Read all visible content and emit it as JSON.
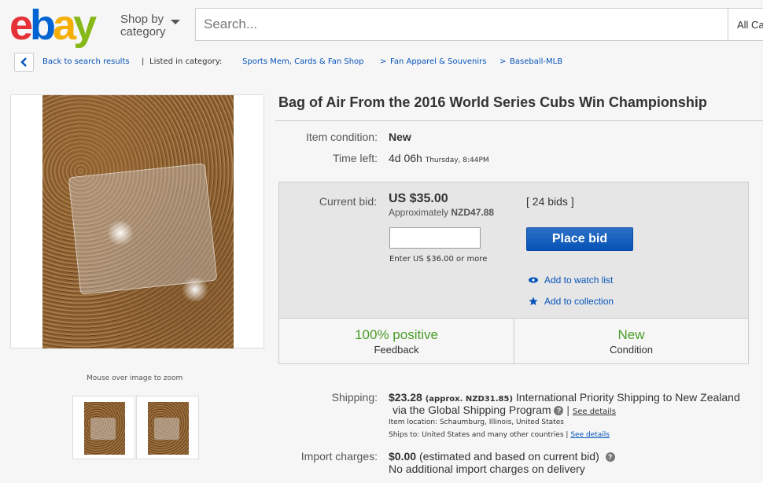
{
  "header": {
    "logo": {
      "e": "e",
      "b": "b",
      "a": "a",
      "y": "y"
    },
    "shop_by_line1": "Shop by",
    "shop_by_line2": "category",
    "search_placeholder": "Search...",
    "category_select": "All Ca"
  },
  "breadcrumb": {
    "back": "Back to search results",
    "separator": "|",
    "listed_in": "Listed in category:",
    "items": [
      "Sports Mem, Cards & Fan Shop",
      "Fan Apparel & Souvenirs",
      "Baseball-MLB"
    ],
    "arrow": ">"
  },
  "gallery": {
    "zoom_hint": "Mouse over image to zoom"
  },
  "item": {
    "title": "Bag of Air From the 2016 World Series Cubs Win Championship",
    "condition_label": "Item condition:",
    "condition_value": "New",
    "time_left_label": "Time left:",
    "time_left_value": "4d 06h",
    "time_left_end": "Thursday, 8:44PM"
  },
  "bid": {
    "current_bid_label": "Current bid:",
    "amount": "US $35.00",
    "approx_prefix": "Approximately",
    "approx_value": "NZD47.88",
    "bids_link": "[ 24 bids ]",
    "input_value": "",
    "hint": "Enter US $36.00 or more",
    "place_bid": "Place bid",
    "watch": "Add to watch list",
    "collection": "Add to collection"
  },
  "stats": [
    {
      "big": "100% positive",
      "small": "Feedback"
    },
    {
      "big": "New",
      "small": "Condition"
    }
  ],
  "shipping": {
    "label": "Shipping:",
    "cost": "$23.28",
    "approx": "(approx. NZD31.85)",
    "service_line1": "International Priority Shipping to New Zealand",
    "service_line2": "via the Global Shipping Program",
    "see_details": "See details",
    "item_location": "Item location:  Schaumburg, Illinois, United States",
    "ships_to": "Ships to:  United States and many other countries |",
    "see_details2": "See details"
  },
  "import": {
    "label": "Import charges:",
    "cost": "$0.00",
    "note": "(estimated and based on current bid)",
    "line2": "No additional import charges on delivery"
  },
  "colors": {
    "link": "#0654ba",
    "positive": "#4a9d27",
    "button": "#0653b7"
  }
}
